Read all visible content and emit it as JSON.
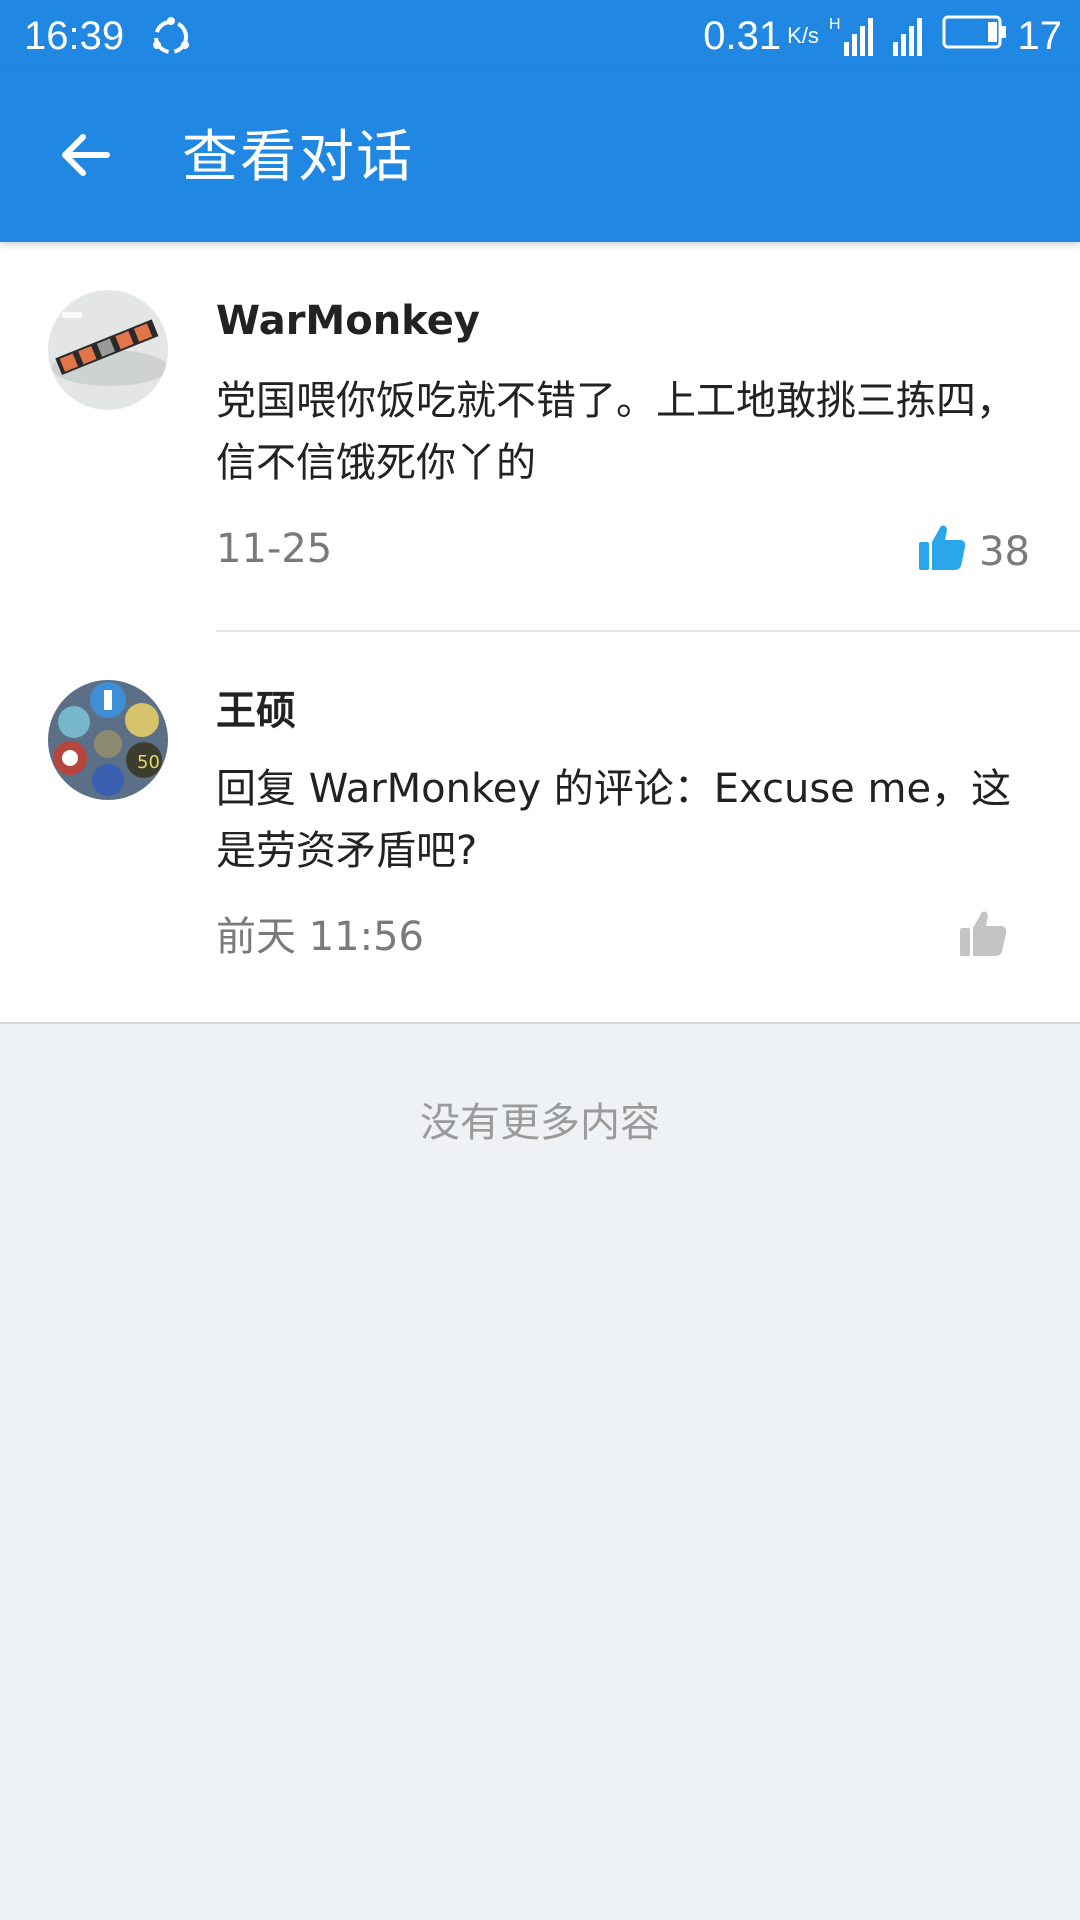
{
  "status_bar": {
    "time": "16:39",
    "net_speed": "0.31",
    "net_speed_unit": "K/s",
    "network_type": "H",
    "battery": "17",
    "sync_icon": "sync-icon",
    "signal_icon": "signal-icon",
    "battery_icon": "battery-icon"
  },
  "app_bar": {
    "title": "查看对话",
    "back_icon": "back-arrow-icon",
    "color": "#2088e2"
  },
  "comments": [
    {
      "author": "WarMonkey",
      "text": "党国喂你饭吃就不错了。上工地敢挑三拣四，信不信饿死你丫的",
      "time": "11-25",
      "likes": "38",
      "liked": true
    },
    {
      "author": "王硕",
      "text": "回复 WarMonkey 的评论：Excuse me，这是劳资矛盾吧?",
      "time": "前天 11:56",
      "likes": "",
      "liked": false
    }
  ],
  "footer": {
    "no_more_text": "没有更多内容"
  },
  "colors": {
    "accent": "#2088e2",
    "like_active": "#2aa7ea",
    "like_inactive": "#c4c4c4",
    "background": "#eff2f4"
  }
}
